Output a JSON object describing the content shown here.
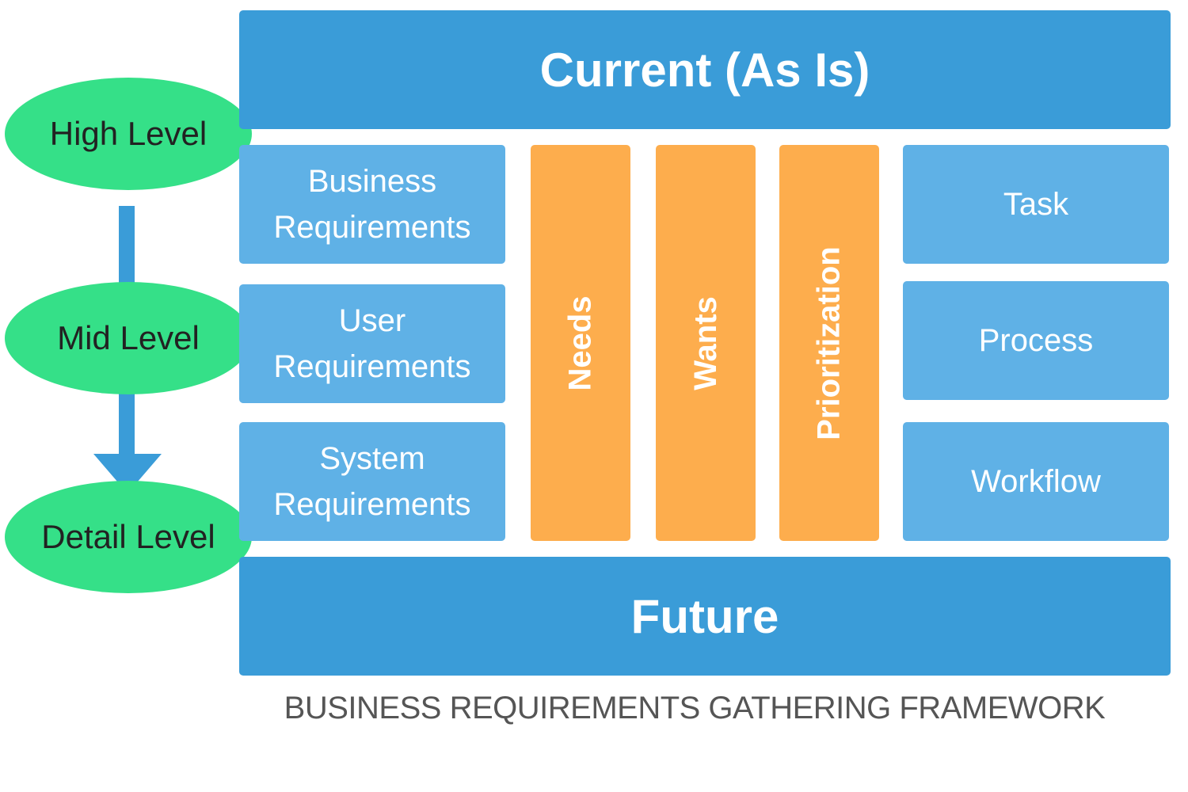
{
  "title": "BUSINESS REQUIREMENTS GATHERING FRAMEWORK",
  "colors": {
    "banner": "#3a9cd8",
    "requirement_box": "#5fb1e6",
    "column": "#fdad4d",
    "level_ellipse": "#35e088",
    "arrow": "#3a9cd8",
    "caption_text": "#555555"
  },
  "banners": {
    "top": "Current (As Is)",
    "bottom": "Future"
  },
  "levels": [
    {
      "label": "High Level"
    },
    {
      "label": "Mid Level"
    },
    {
      "label": "Detail Level"
    }
  ],
  "requirements": [
    {
      "line1": "Business",
      "line2": "Requirements"
    },
    {
      "line1": "User",
      "line2": "Requirements"
    },
    {
      "line1": "System",
      "line2": "Requirements"
    }
  ],
  "columns": [
    {
      "label": "Needs"
    },
    {
      "label": "Wants"
    },
    {
      "label": "Prioritization"
    }
  ],
  "aspects": [
    {
      "label": "Task"
    },
    {
      "label": "Process"
    },
    {
      "label": "Workflow"
    }
  ]
}
